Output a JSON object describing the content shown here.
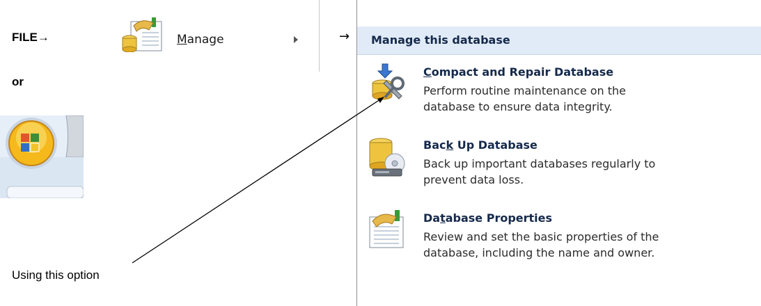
{
  "left": {
    "file_label": "FILE→",
    "or_label": "or",
    "using_label": "Using this option"
  },
  "manage_item": {
    "label": "Manage",
    "arrow": "→"
  },
  "panel": {
    "header": "Manage this database",
    "options": [
      {
        "title": "Compact and Repair Database",
        "desc_line1": "Perform routine maintenance on the",
        "desc_line2": "database to ensure data integrity."
      },
      {
        "title": "Back Up Database",
        "desc_line1": "Back up important databases regularly to",
        "desc_line2": "prevent data loss."
      },
      {
        "title": "Database Properties",
        "desc_line1": "Review and set the basic properties of the",
        "desc_line2": "database, including the name and owner."
      }
    ]
  },
  "colors": {
    "panel_header_bg": "#e1ebf7",
    "title_color": "#15294b"
  }
}
